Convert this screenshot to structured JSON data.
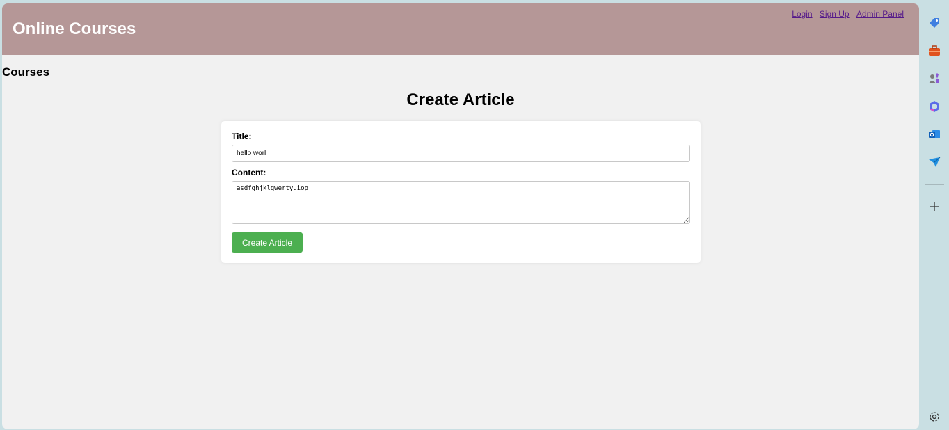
{
  "header": {
    "site_title": "Online Courses",
    "nav": [
      "Login",
      "Sign Up",
      "Admin Panel"
    ]
  },
  "courses_heading": "Courses",
  "form": {
    "page_title": "Create Article",
    "title_label": "Title:",
    "title_value": "hello worl",
    "content_label": "Content:",
    "content_value": "asdfghjklqwertyuiop",
    "submit_label": "Create Article"
  },
  "sidebar": {
    "icons": [
      "tag-icon",
      "toolbox-icon",
      "people-icon",
      "copilot-icon",
      "outlook-icon",
      "send-icon",
      "add-icon",
      "settings-icon"
    ]
  },
  "colors": {
    "header_bg": "#b59797",
    "button_bg": "#4caf50",
    "page_bg": "#f1f1f1",
    "link": "#551a8b"
  }
}
